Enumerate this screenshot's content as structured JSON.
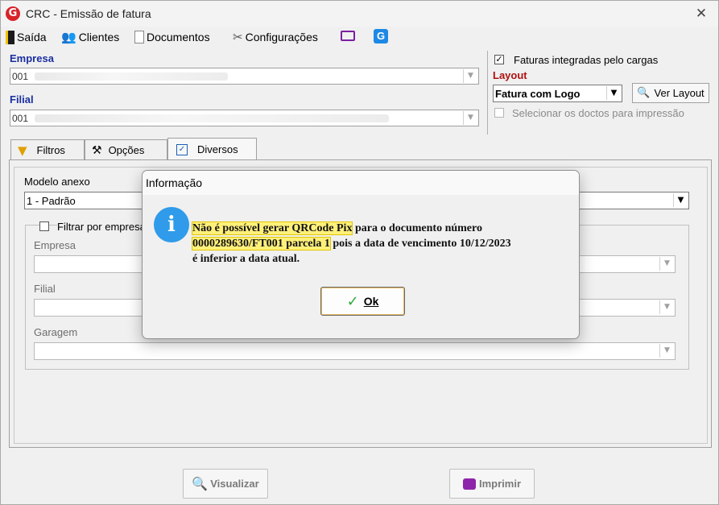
{
  "window": {
    "title": "CRC - Emissão de fatura",
    "logo_letter": "G",
    "close_glyph": "✕"
  },
  "menu": {
    "items": [
      {
        "label": "Saída",
        "icon": "exit-door-icon"
      },
      {
        "label": "Clientes",
        "icon": "clients-icon"
      },
      {
        "label": "Documentos",
        "icon": "document-icon"
      },
      {
        "label": "Configurações",
        "icon": "tools-icon"
      }
    ],
    "extra_icons": [
      "monitor-icon",
      "g-logo-icon"
    ]
  },
  "form": {
    "empresa_label": "Empresa",
    "empresa_value": "001",
    "filial_label": "Filial",
    "filial_value": "001",
    "faturas_integradas": {
      "label": "Faturas integradas pelo cargas",
      "checked": true
    },
    "layout_label": "Layout",
    "layout_value": "Fatura com Logo",
    "ver_layout_label": "Ver Layout",
    "selecionar_doctos": {
      "label": "Selecionar os doctos para impressão",
      "checked": false
    }
  },
  "tabs": [
    {
      "label": "Filtros",
      "icon": "filter-funnel-icon"
    },
    {
      "label": "Opções",
      "icon": "options-tools-icon"
    },
    {
      "label": "Diversos",
      "icon": "checkbox-icon",
      "active": true
    }
  ],
  "diversos": {
    "modelo_anexo_label": "Modelo anexo",
    "modelo_anexo_value": "1 - Padrão",
    "filtrar_por_empresa": {
      "label": "Filtrar por empresa",
      "checked": false
    },
    "empresa_label": "Empresa",
    "filial_label": "Filial",
    "garagem_label": "Garagem"
  },
  "dialog": {
    "title": "Informação",
    "icon": "info-icon",
    "message_highlight_1": "Não é possível gerar QRCode Pix",
    "message_part_1": " para o documento número",
    "message_highlight_2": "0000289630/FT001 parcela 1",
    "message_part_2": " pois a data de vencimento 10/12/2023",
    "message_part_3": "é inferior a data atual.",
    "ok_label": "Ok"
  },
  "buttons": {
    "visualizar_label": "Visualizar",
    "imprimir_label": "Imprimir"
  }
}
